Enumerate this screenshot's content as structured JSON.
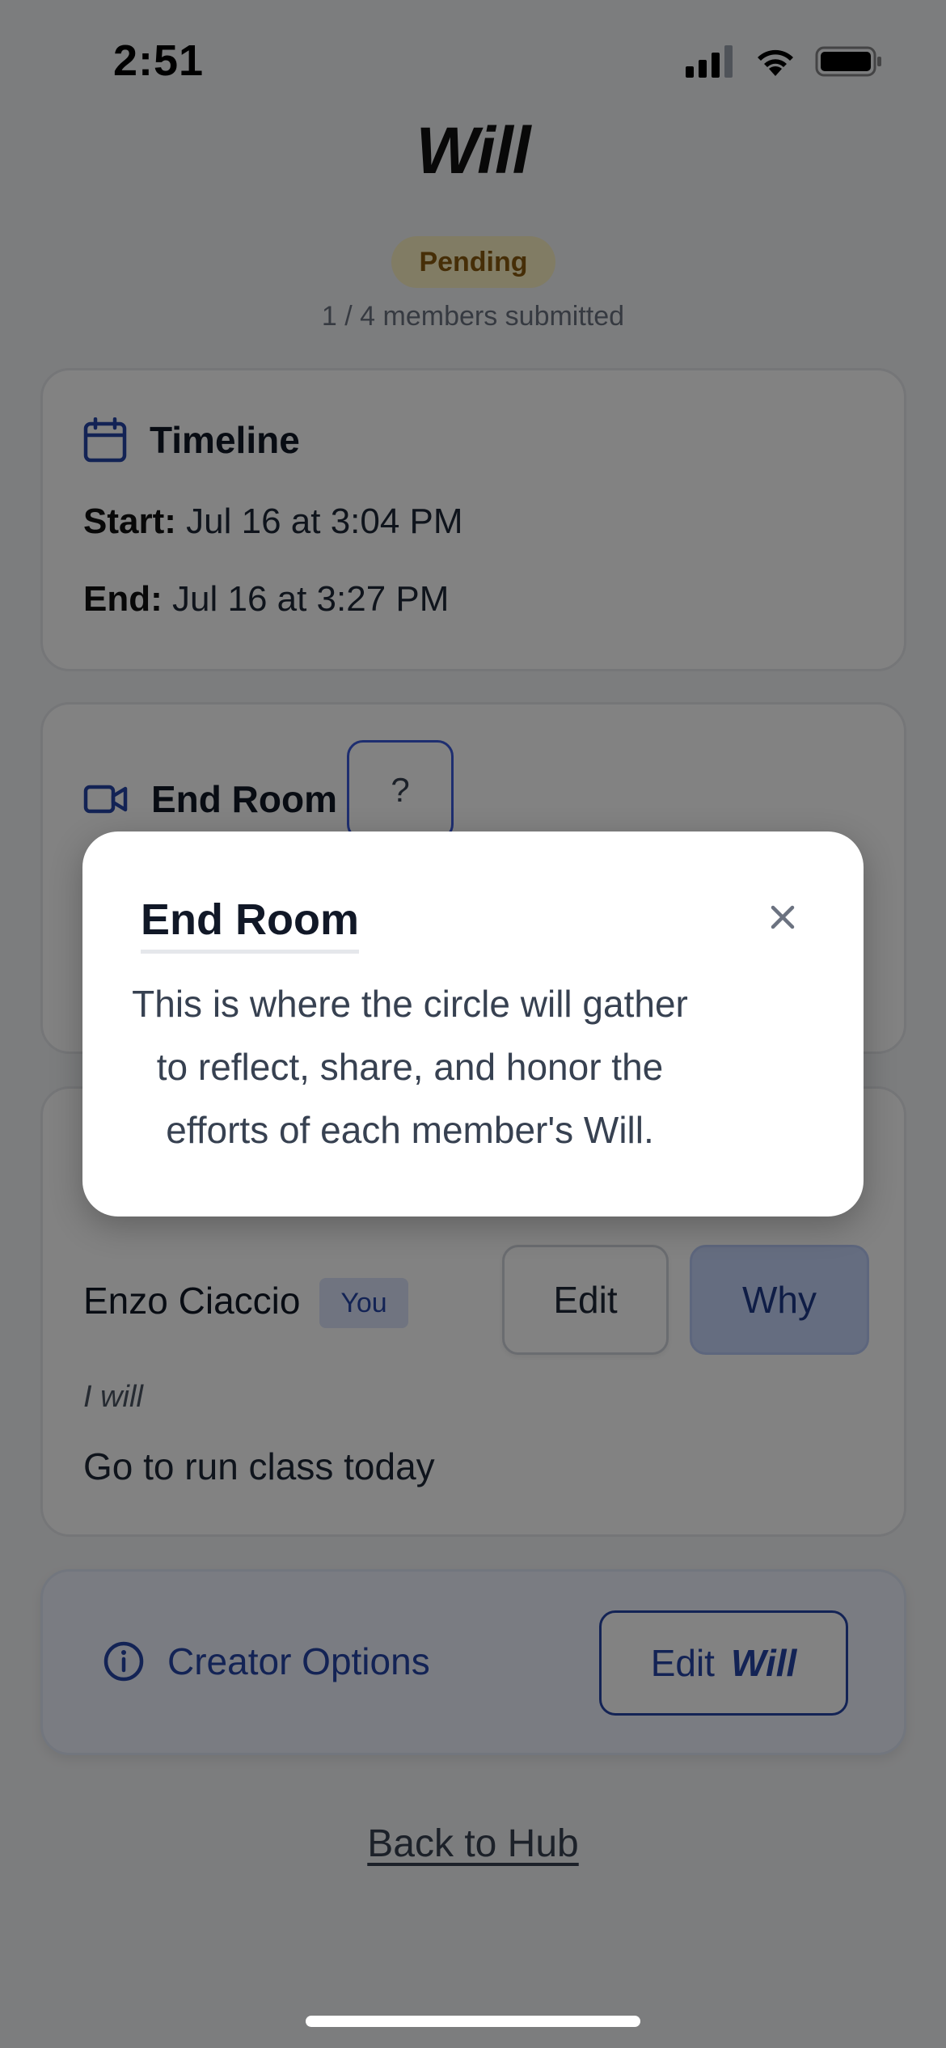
{
  "status_bar": {
    "time": "2:51"
  },
  "page": {
    "title": "Will",
    "status_badge": "Pending",
    "submitted_text": "1 / 4 members submitted"
  },
  "timeline": {
    "heading": "Timeline",
    "start_label": "Start:",
    "start_value": "Jul 16 at 3:04 PM",
    "end_label": "End:",
    "end_value": "Jul 16 at 3:27 PM"
  },
  "end_room": {
    "heading": "End Room",
    "help_label": "?"
  },
  "member": {
    "name": "Enzo Ciaccio",
    "you_badge": "You",
    "edit_label": "Edit",
    "why_label": "Why",
    "i_will_label": "I will",
    "will_text": "Go to run class today"
  },
  "creator": {
    "label": "Creator Options",
    "edit_will_prefix": "Edit",
    "edit_will_suffix": "Will"
  },
  "back_link": "Back to Hub",
  "modal": {
    "title": "End Room",
    "body": "This is where the circle will gather to reflect, share, and honor the efforts of each member's Will."
  },
  "colors": {
    "accent": "#2745a8",
    "pending_bg": "#fdf3c4",
    "pending_text": "#8a5a0e",
    "overlay": "rgba(0,0,0,0.49)"
  }
}
